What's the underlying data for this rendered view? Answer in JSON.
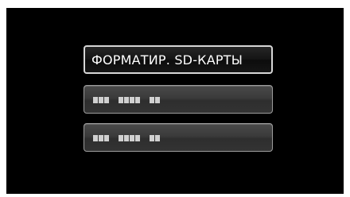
{
  "menu": {
    "items": [
      {
        "label": "ФОРМАТИР. SD-КАРТЫ",
        "selected": true
      },
      {
        "label": "",
        "selected": false
      },
      {
        "label": "",
        "selected": false
      }
    ]
  },
  "colors": {
    "screen_background": "#000000",
    "selected_border": "#d6d6d6",
    "item_border": "#9c9c9c",
    "item_fill": "#3a3a3a",
    "text": "#ffffff"
  }
}
